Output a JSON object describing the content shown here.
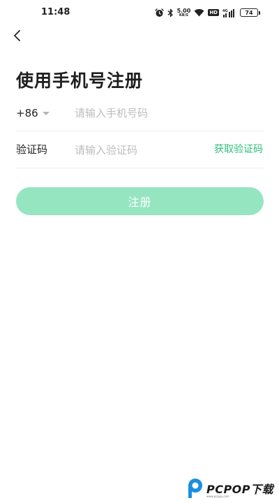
{
  "status_bar": {
    "time": "11:48",
    "net_speed_value": "5.00",
    "net_speed_unit": "KB/S",
    "hd_label": "HD",
    "signal_label": "4G",
    "battery_level": "74"
  },
  "header": {
    "back_icon": "chevron-left-icon",
    "title": "使用手机号注册"
  },
  "form": {
    "phone": {
      "country_code": "+86",
      "placeholder": "请输入手机号码",
      "value": ""
    },
    "code": {
      "label": "验证码",
      "placeholder": "请输入验证码",
      "value": "",
      "get_code_label": "获取验证码"
    },
    "submit_label": "注册"
  },
  "watermark": {
    "text": "PCPOP下载",
    "sub_text": "www.pcpop.com"
  },
  "colors": {
    "accent": "#2ec07e",
    "button_disabled": "#96e5c1",
    "placeholder": "#bdbdbd",
    "divider": "#ececec"
  }
}
